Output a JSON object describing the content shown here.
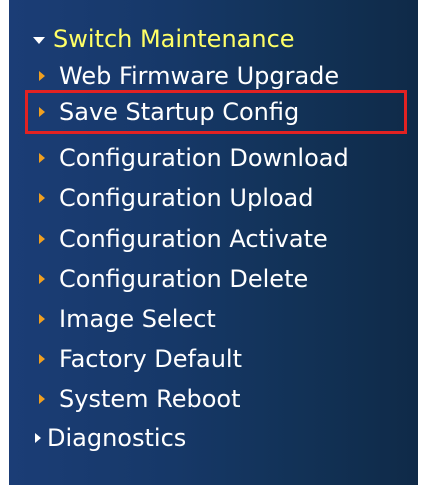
{
  "menu": {
    "header": "Switch Maintenance",
    "items": [
      {
        "label": "Web Firmware Upgrade"
      },
      {
        "label": "Save Startup Config"
      },
      {
        "label": "Configuration Download"
      },
      {
        "label": "Configuration Upload"
      },
      {
        "label": "Configuration Activate"
      },
      {
        "label": "Configuration Delete"
      },
      {
        "label": "Image Select"
      },
      {
        "label": "Factory Default"
      },
      {
        "label": "System Reboot"
      }
    ],
    "next_section": "Diagnostics"
  },
  "colors": {
    "panel": "#163868",
    "header_text": "#ffff66",
    "item_text": "#ffffff",
    "item_caret": "#f0a020",
    "highlight_border": "#e22222"
  },
  "icons": {
    "expanded": "caret-down-icon",
    "item": "caret-right-icon"
  }
}
